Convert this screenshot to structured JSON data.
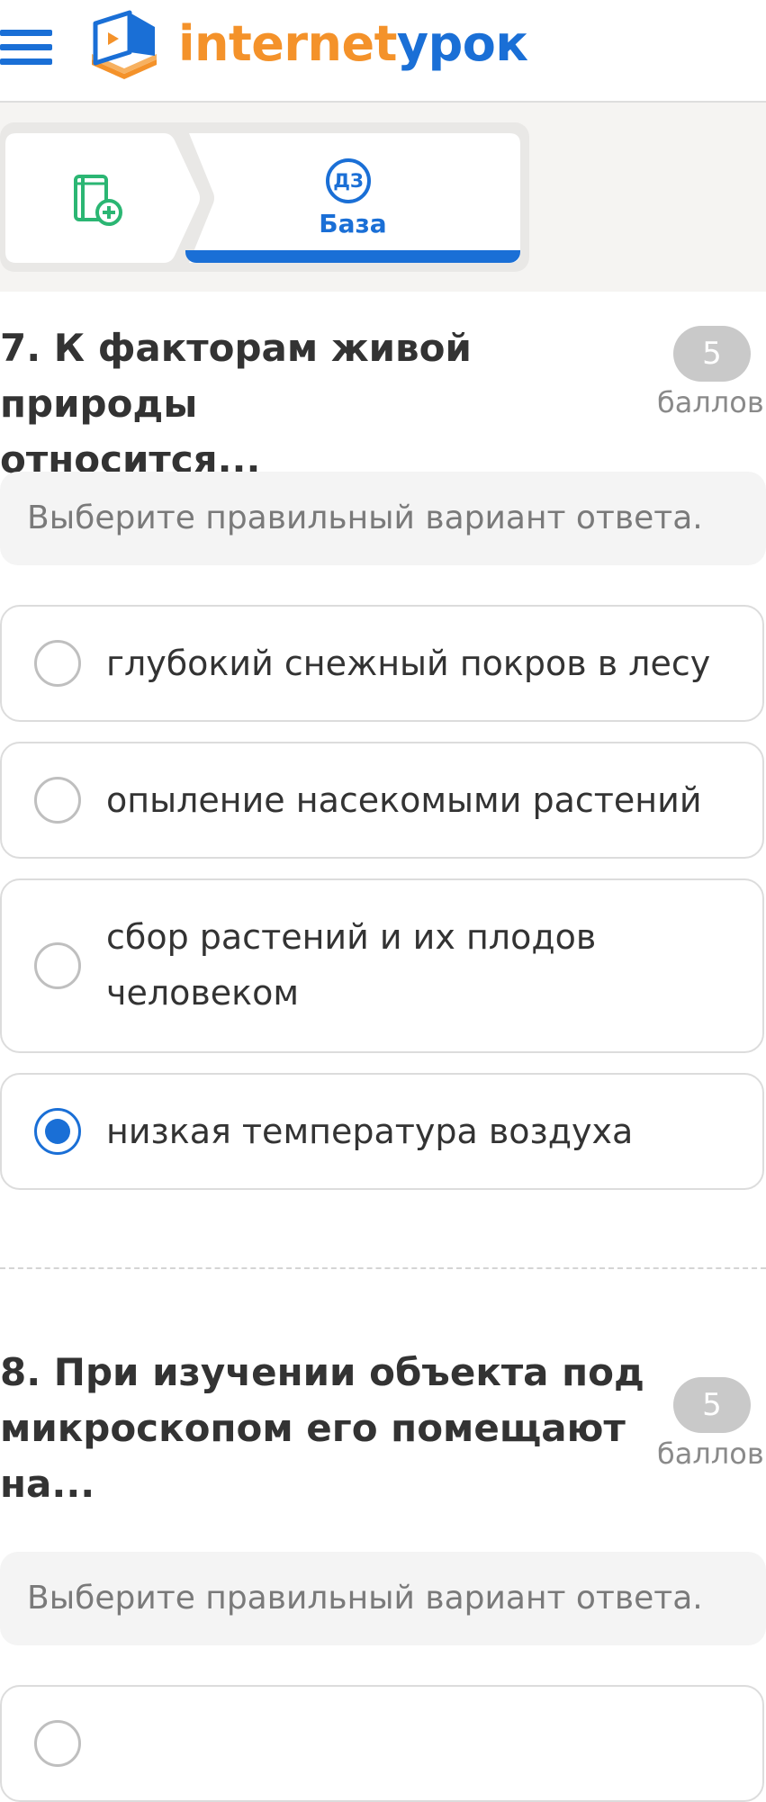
{
  "header": {
    "logo_part1": "internet",
    "logo_part2": "урок",
    "menu_icon": "hamburger-menu-icon",
    "logo_icon": "book-laptop-logo-icon",
    "colors": {
      "orange": "#f4922a",
      "blue": "#1a6fd6"
    }
  },
  "steps": {
    "first_icon": "green-book-plus-icon",
    "active_badge": "ДЗ",
    "active_label": "База"
  },
  "questions": [
    {
      "title_line1": "7. К факторам живой природы",
      "title_line2": "относится...",
      "points": "5",
      "points_label": "баллов",
      "instruction": "Выберите правильный вариант ответа.",
      "options": [
        {
          "line1": "глубокий снежный покров в лесу",
          "selected": false
        },
        {
          "line1": "опыление насекомыми растений",
          "selected": false
        },
        {
          "line1": "сбор растений и их плодов",
          "line2": "человеком",
          "selected": false
        },
        {
          "line1": "низкая температура воздуха",
          "selected": true
        }
      ]
    },
    {
      "title_line1": "8. При изучении объекта под",
      "title_line2": "микроскопом его помещают",
      "title_line3": "на...",
      "points": "5",
      "points_label": "баллов",
      "instruction": "Выберите правильный вариант ответа."
    }
  ]
}
